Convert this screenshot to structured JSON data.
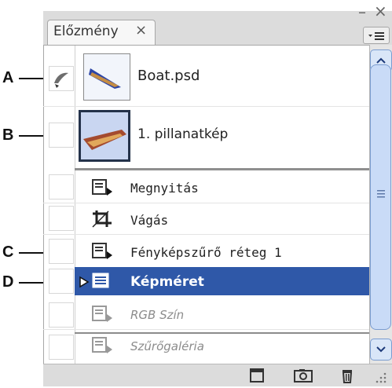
{
  "panel": {
    "tab_label": "Előzmény",
    "tab_close_glyph": "×",
    "window_minimize_glyph": "–",
    "window_close_glyph": "×",
    "menu_icon": "panel-menu-icon"
  },
  "callouts": {
    "a": "A",
    "b": "B",
    "c": "C",
    "d": "D"
  },
  "rows": {
    "document": {
      "label": "Boat.psd",
      "icon": "history-brush-icon"
    },
    "snapshot": {
      "label": "1. pillanatkép"
    },
    "steps": [
      {
        "label": "Megnyitás",
        "icon": "history-step-icon",
        "state": "normal"
      },
      {
        "label": "Vágás",
        "icon": "crop-icon",
        "state": "normal"
      },
      {
        "label": "Fényképszűrő réteg 1",
        "icon": "history-step-icon",
        "state": "normal"
      },
      {
        "label": "Képméret",
        "icon": "history-step-icon",
        "state": "selected"
      },
      {
        "label": "RGB Szín",
        "icon": "history-step-icon",
        "state": "disabled"
      },
      {
        "label": "Szűrőgaléria",
        "icon": "history-step-icon",
        "state": "disabled"
      }
    ]
  },
  "colors": {
    "selection": "#2f58a8",
    "disabled_text": "#8c8c8c",
    "scrollbar": "#c9dbf7"
  },
  "toolbar": {
    "buttons": [
      {
        "icon": "create-new-document-icon"
      },
      {
        "icon": "create-new-snapshot-icon"
      },
      {
        "icon": "delete-trash-icon"
      }
    ]
  }
}
